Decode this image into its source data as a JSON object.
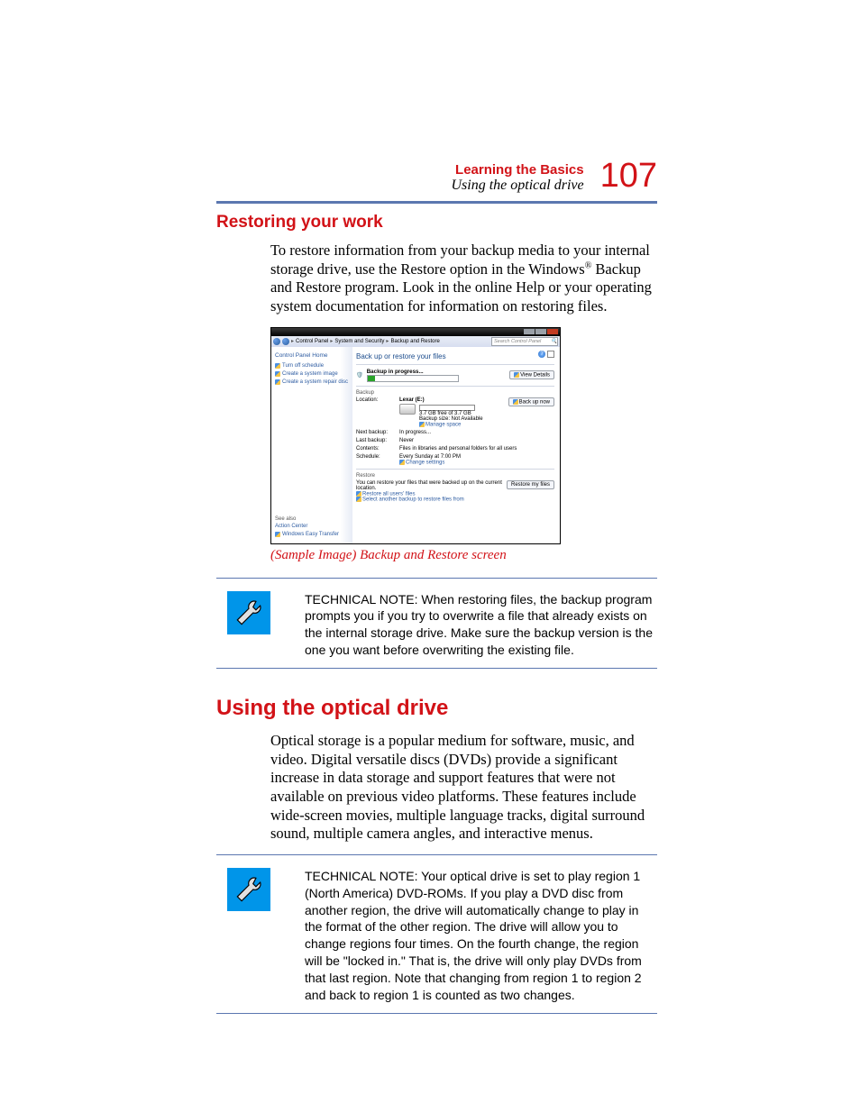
{
  "header": {
    "chapter": "Learning the Basics",
    "section_sub": "Using the optical drive",
    "page_number": "107"
  },
  "h_restoring": "Restoring your work",
  "p_restoring_1a": "To restore information from your backup media to your internal storage drive, use the Restore option in the Windows",
  "p_restoring_1b": " Backup and Restore program. Look in the online Help or your operating system documentation for information on restoring files.",
  "regmark": "®",
  "screenshot": {
    "breadcrumb": {
      "item1": "Control Panel",
      "item2": "System and Security",
      "item3": "Backup and Restore"
    },
    "search_placeholder": "Search Control Panel",
    "sidebar": {
      "home": "Control Panel Home",
      "link1": "Turn off schedule",
      "link2": "Create a system image",
      "link3": "Create a system repair disc",
      "see_also": "See also",
      "see1": "Action Center",
      "see2": "Windows Easy Transfer"
    },
    "main": {
      "title": "Back up or restore your files",
      "backup_in_progress": "Backup in progress...",
      "view_details": "View Details",
      "section_backup": "Backup",
      "location_lbl": "Location:",
      "location_val": "Lexar (E:)",
      "space_line": "3.7 GB free of 3.7 GB",
      "size_line": "Backup size: Not Available",
      "manage_space": "Manage space",
      "backup_now": "Back up now",
      "next_lbl": "Next backup:",
      "next_val": "In progress...",
      "last_lbl": "Last backup:",
      "last_val": "Never",
      "contents_lbl": "Contents:",
      "contents_val": "Files in libraries and personal folders for all users",
      "schedule_lbl": "Schedule:",
      "schedule_val": "Every Sunday at 7:00 PM",
      "change_settings": "Change settings",
      "section_restore": "Restore",
      "restore_text": "You can restore your files that were backed up on the current location.",
      "restore_btn": "Restore my files",
      "restore_all": "Restore all users' files",
      "restore_other": "Select another backup to restore files from"
    }
  },
  "caption1": "(Sample Image) Backup and Restore screen",
  "technote1": "TECHNICAL NOTE: When restoring files, the backup program prompts you if you try to overwrite a file that already exists on the internal storage drive. Make sure the backup version is the one you want before overwriting the existing file.",
  "h_optical": "Using the optical drive",
  "p_optical": "Optical storage is a popular medium for software, music, and video. Digital versatile discs (DVDs) provide a significant increase in data storage and support features that were not available on previous video platforms. These features include wide-screen movies, multiple language tracks, digital surround sound, multiple camera angles, and interactive menus.",
  "technote2": "TECHNICAL NOTE: Your optical drive is set to play region 1 (North America) DVD-ROMs. If you play a DVD disc from another region, the drive will automatically change to play in the format of the other region. The drive will allow you to change regions four times. On the fourth change, the region will be \"locked in.\" That is, the drive will only play DVDs from that last region. Note that changing from region 1 to region 2 and back to region 1 is counted as two changes."
}
